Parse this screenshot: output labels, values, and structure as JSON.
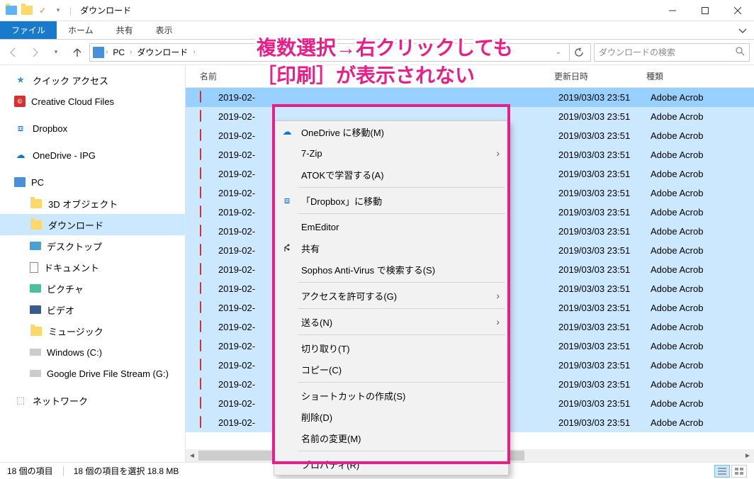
{
  "window": {
    "title": "ダウンロード"
  },
  "ribbon": {
    "file": "ファイル",
    "home": "ホーム",
    "share": "共有",
    "view": "表示"
  },
  "breadcrumb": {
    "pc": "PC",
    "folder": "ダウンロード"
  },
  "search": {
    "placeholder": "ダウンロードの検索"
  },
  "sidebar": {
    "quick_access": "クイック アクセス",
    "creative_cloud": "Creative Cloud Files",
    "dropbox": "Dropbox",
    "onedrive": "OneDrive - IPG",
    "pc": "PC",
    "objects3d": "3D オブジェクト",
    "downloads": "ダウンロード",
    "desktop": "デスクトップ",
    "documents": "ドキュメント",
    "pictures": "ピクチャ",
    "videos": "ビデオ",
    "music": "ミュージック",
    "windows_c": "Windows (C:)",
    "gdrive": "Google Drive File Stream (G:)",
    "network": "ネットワーク"
  },
  "columns": {
    "name": "名前",
    "date": "更新日時",
    "type": "種類"
  },
  "file": {
    "name_prefix": "2019-02-",
    "date": "2019/03/03 23:51",
    "type": "Adobe Acrob"
  },
  "context_menu": {
    "onedrive": "OneDrive に移動(M)",
    "sevenzip": "7-Zip",
    "atok": "ATOKで学習する(A)",
    "dropbox": "「Dropbox」に移動",
    "emeditor": "EmEditor",
    "share": "共有",
    "sophos": "Sophos Anti-Virus で検索する(S)",
    "access": "アクセスを許可する(G)",
    "send": "送る(N)",
    "cut": "切り取り(T)",
    "copy": "コピー(C)",
    "shortcut": "ショートカットの作成(S)",
    "delete": "削除(D)",
    "rename": "名前の変更(M)",
    "properties": "プロパティ(R)"
  },
  "statusbar": {
    "items": "18 個の項目",
    "selected": "18 個の項目を選択 18.8 MB"
  },
  "annotation": {
    "line1": "複数選択→右クリックしても",
    "line2": "［印刷］が表示されない"
  }
}
